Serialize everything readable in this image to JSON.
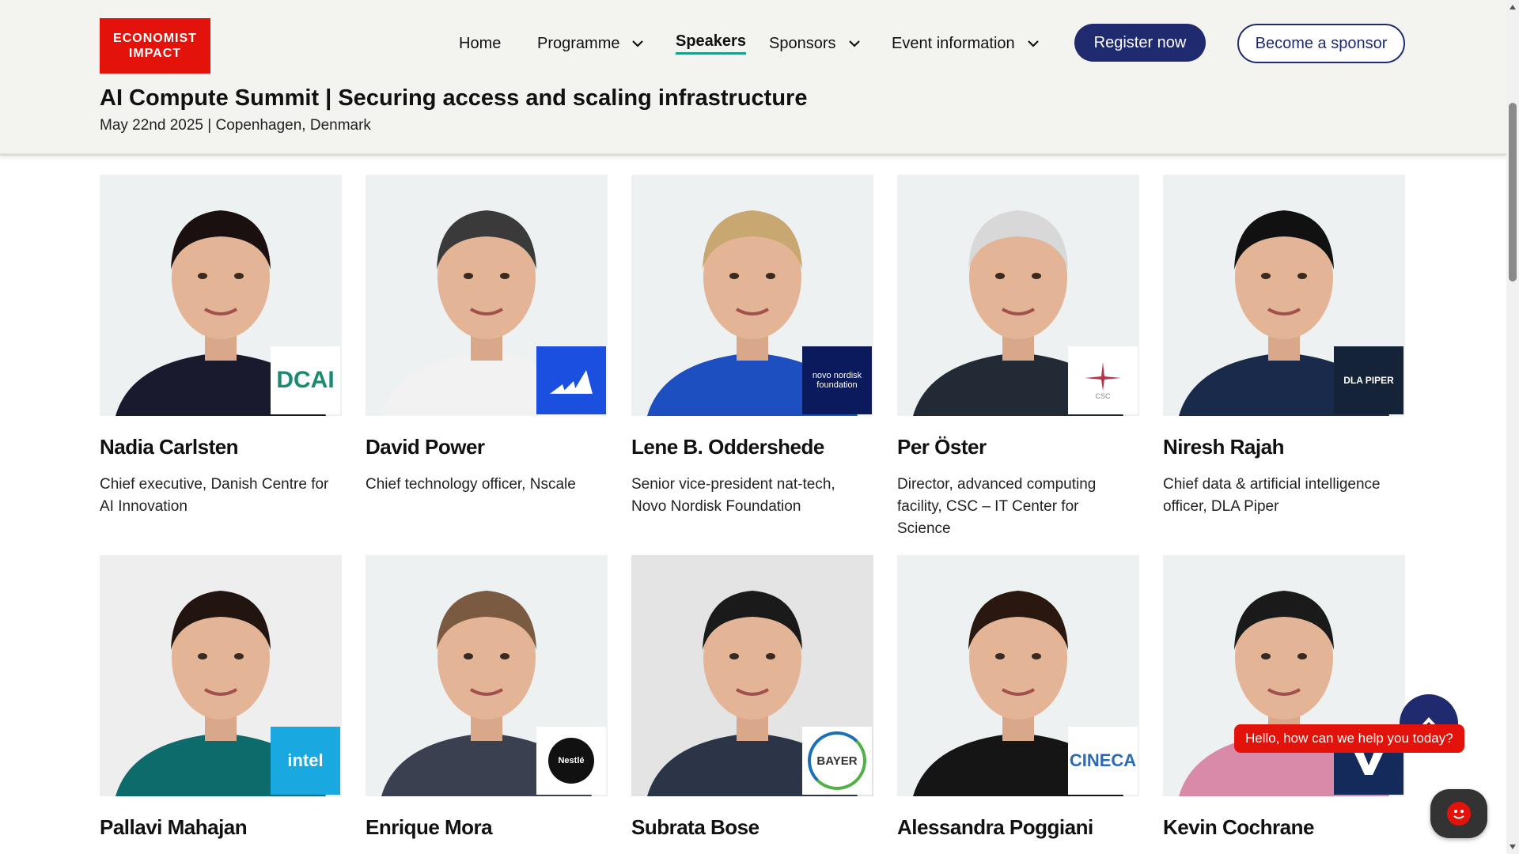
{
  "brand": {
    "line1": "ECONOMIST",
    "line2": "IMPACT",
    "color": "#e3120b"
  },
  "nav": {
    "home": "Home",
    "programme": "Programme",
    "speakers": "Speakers",
    "sponsors": "Sponsors",
    "event_info": "Event information",
    "register": "Register now",
    "become_sponsor": "Become a sponsor"
  },
  "event": {
    "title": "AI Compute Summit | Securing access and scaling infrastructure",
    "subtitle": "May 22nd 2025 | Copenhagen, Denmark"
  },
  "speakers": [
    {
      "name": "Nadia Carlsten",
      "title": "Chief executive, Danish Centre for AI Innovation",
      "logo": "DCAI",
      "logo_bg": "#ffffff",
      "logo_fg": "#1b8a6f",
      "shirt": "#1a1a2e",
      "hair": "#1a1010",
      "bg": "#eef1f1"
    },
    {
      "name": "David Power",
      "title": "Chief technology officer, Nscale",
      "logo": "",
      "logo_bg": "#1a4fe0",
      "logo_fg": "#ffffff",
      "shirt": "#f2f2f2",
      "hair": "#3a3a3a",
      "bg": "#eef1f1"
    },
    {
      "name": "Lene B. Oddershede",
      "title": "Senior vice-president nat-tech, Novo Nordisk Foundation",
      "logo": "novo nordisk foundation",
      "logo_bg": "#0a1a5c",
      "logo_fg": "#ffffff",
      "shirt": "#1e4fc0",
      "hair": "#c8a870",
      "bg": "#eef1f1"
    },
    {
      "name": "Per Öster",
      "title": "Director, advanced computing facility, CSC – IT Center for Science",
      "logo": "CSC",
      "logo_bg": "#ffffff",
      "logo_fg": "#888888",
      "shirt": "#222a35",
      "hair": "#d8d8d8",
      "bg": "#eef1f1"
    },
    {
      "name": "Niresh Rajah",
      "title": "Chief data & artificial intelligence officer, DLA Piper",
      "logo": "DLA PIPER",
      "logo_bg": "#142338",
      "logo_fg": "#ffffff",
      "shirt": "#1a2a4a",
      "hair": "#111111",
      "bg": "#eef1f1"
    },
    {
      "name": "Pallavi Mahajan",
      "title": "",
      "logo": "intel",
      "logo_bg": "#1aa8e0",
      "logo_fg": "#ffffff",
      "shirt": "#0d6b6b",
      "hair": "#221510",
      "bg": "#eeeeee"
    },
    {
      "name": "Enrique Mora",
      "title": "",
      "logo": "Nestlé",
      "logo_bg": "#ffffff",
      "logo_fg": "#111111",
      "shirt": "#3a4050",
      "hair": "#7a5a40",
      "bg": "#eef1f1"
    },
    {
      "name": "Subrata Bose",
      "title": "",
      "logo": "BAYER",
      "logo_bg": "#ffffff",
      "logo_fg": "#333333",
      "shirt": "#2c3548",
      "hair": "#1a1a1a",
      "bg": "#e4e4e4"
    },
    {
      "name": "Alessandra Poggiani",
      "title": "",
      "logo": "CINECA",
      "logo_bg": "#ffffff",
      "logo_fg": "#2a6ab8",
      "shirt": "#151515",
      "hair": "#2a1810",
      "bg": "#eef1f1"
    },
    {
      "name": "Kevin Cochrane",
      "title": "",
      "logo": "V",
      "logo_bg": "#142a5a",
      "logo_fg": "#ffffff",
      "shirt": "#d98aa8",
      "hair": "#1a1a1a",
      "bg": "#eef1f1"
    }
  ],
  "chat": {
    "prompt": "Hello, how can we help you today?"
  }
}
